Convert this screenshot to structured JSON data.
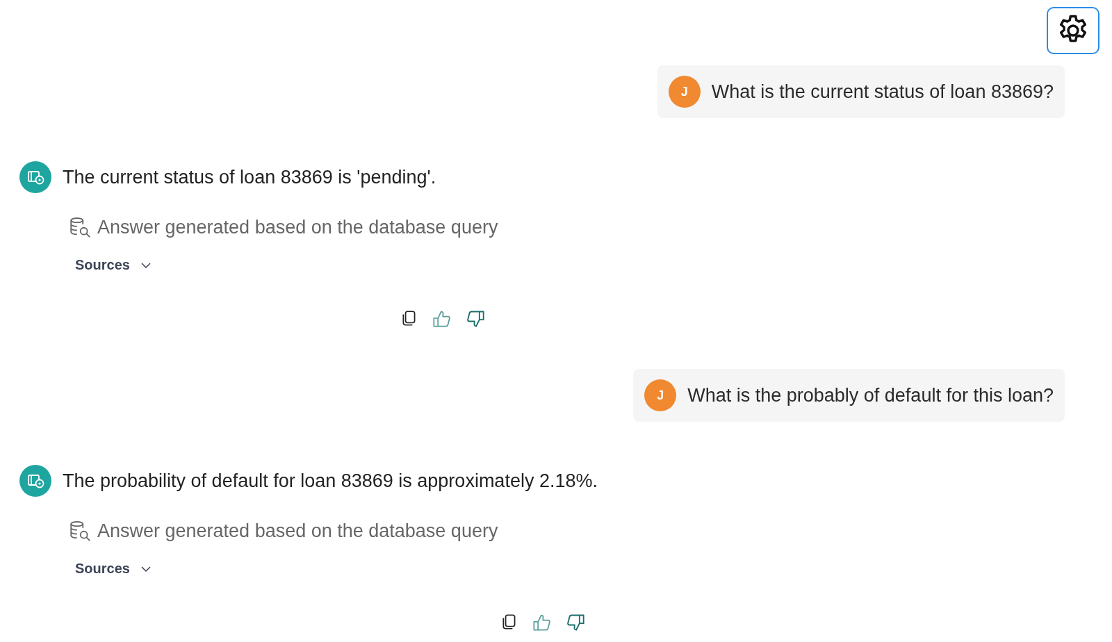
{
  "messages": [
    {
      "kind": "user",
      "avatar": "J",
      "text": "What is the current status of loan 83869?"
    },
    {
      "kind": "assistant",
      "text": "The current status of loan 83869 is 'pending'.",
      "note": "Answer generated based on the database query",
      "sources": {
        "label": "Sources",
        "expanded": false
      }
    },
    {
      "kind": "user",
      "avatar": "J",
      "text": "What is the probably of default for this loan?"
    },
    {
      "kind": "assistant",
      "text": "The probability of default for loan 83869 is approximately 2.18%.",
      "note": "Answer generated based on the database query",
      "sources": {
        "label": "Sources",
        "expanded": false
      }
    }
  ]
}
